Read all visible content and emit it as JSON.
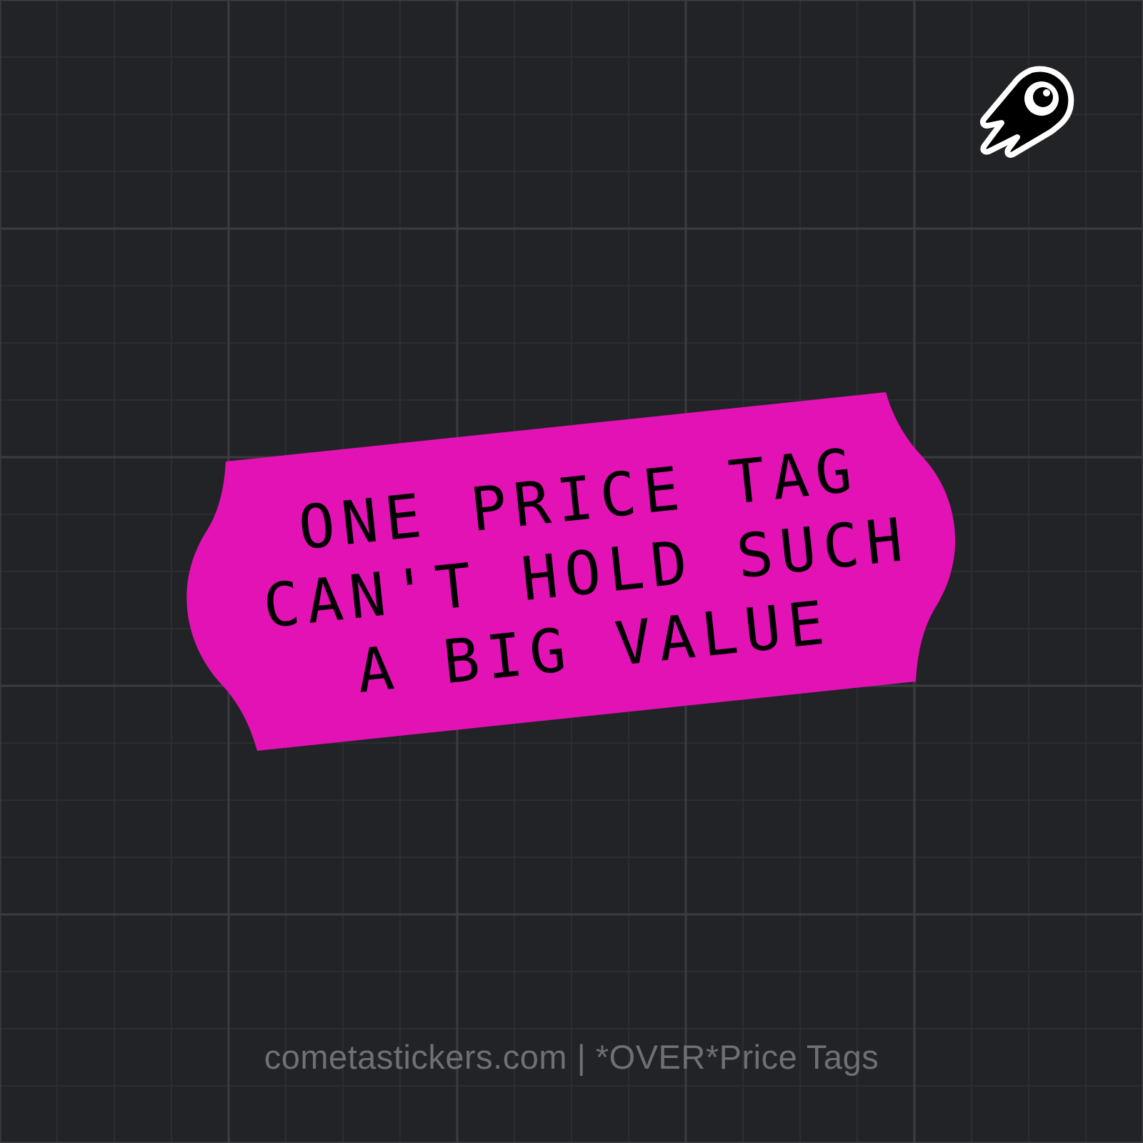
{
  "colors": {
    "background": "#222326",
    "grid_fine": "#2c2d31",
    "grid_major": "#3b3c40",
    "tag_fill": "#e312b5",
    "tag_text": "#000000",
    "footer_text": "#6f7074",
    "logo_fill": "#000000",
    "logo_outline": "#ffffff"
  },
  "logo": {
    "icon": "comet-eye-icon"
  },
  "price_tag": {
    "lines": [
      "ONE PRICE TAG",
      "CAN'T HOLD SUCH",
      "A BIG VALUE"
    ]
  },
  "footer": {
    "text": "cometastickers.com | *OVER*Price Tags"
  }
}
